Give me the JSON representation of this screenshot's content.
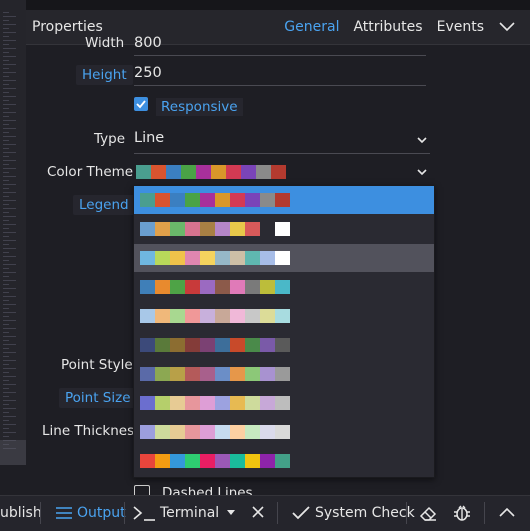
{
  "header": {
    "title": "Properties",
    "tabs": [
      {
        "label": "General",
        "active": true
      },
      {
        "label": "Attributes",
        "active": false
      },
      {
        "label": "Events",
        "active": false
      }
    ]
  },
  "fields": {
    "width_label": "Width",
    "width_value": "800",
    "height_label": "Height",
    "height_value": "250",
    "responsive_label": "Responsive",
    "responsive_checked": true,
    "type_label": "Type",
    "type_value": "Line",
    "color_theme_label": "Color Theme",
    "legend_label": "Legend",
    "point_style_label": "Point Style",
    "point_size_label": "Point Size",
    "line_thickness_label": "Line Thickness",
    "dashed_lines_label": "Dashed Lines"
  },
  "color_theme_selected": [
    "#4a9e8f",
    "#d9542f",
    "#3b7fc1",
    "#4aa346",
    "#a8309b",
    "#d9972a",
    "#d33a53",
    "#7a44b8",
    "#8a8a8a",
    "#b33a2f"
  ],
  "color_themes": [
    [
      "#4a9e8f",
      "#d9542f",
      "#3b7fc1",
      "#4aa346",
      "#a8309b",
      "#d9972a",
      "#d33a53",
      "#7a44b8",
      "#8a8a8a",
      "#b33a2f"
    ],
    [
      "#6a9ecf",
      "#e0a04a",
      "#6ab86a",
      "#d7738f",
      "#a88044",
      "#b586c7",
      "#e7c84a",
      "#d85a5a",
      "#2a2a32",
      "#ffffff"
    ],
    [
      "#6fb7e0",
      "#b8d85a",
      "#f0c24a",
      "#e086b0",
      "#f4d35e",
      "#96b8c8",
      "#cdbfa6",
      "#5fb8b0",
      "#a7bde8",
      "#ffffff"
    ],
    [
      "#3f7fb8",
      "#e88a2e",
      "#4ea346",
      "#c83a3a",
      "#9b6ac1",
      "#8c5a4a",
      "#e07ab8",
      "#7a7a7a",
      "#bcbd3a",
      "#4ab8c8"
    ],
    [
      "#a8c8e8",
      "#f0b87a",
      "#a8d890",
      "#f09898",
      "#c8b0dc",
      "#c8a898",
      "#f0b8d8",
      "#c8c8c8",
      "#dcdc98",
      "#a8dce0"
    ],
    [
      "#3c4a7a",
      "#5a7a3a",
      "#8c6d31",
      "#843c39",
      "#7b4173",
      "#3d6e9a",
      "#c84a2a",
      "#4a8a4a",
      "#7a5aa8",
      "#5a5a5a"
    ],
    [
      "#5a6aa8",
      "#8ca852",
      "#b8a048",
      "#b45a5a",
      "#a8608c",
      "#6b8ec7",
      "#e6974a",
      "#8cc878",
      "#a892d0",
      "#9a9a9a"
    ],
    [
      "#6b6ecf",
      "#b5cf6b",
      "#e7cb94",
      "#e7969c",
      "#de9ed6",
      "#9ca2e0",
      "#e7ba52",
      "#cedb9c",
      "#c7a8d8",
      "#bdbdbd"
    ],
    [
      "#9c9ede",
      "#cedb9c",
      "#e7cb94",
      "#e7969c",
      "#de9ed6",
      "#c6dbef",
      "#fdd0a2",
      "#c7e9c0",
      "#dadaeb",
      "#d9d9d9"
    ],
    [
      "#e8453c",
      "#f39c12",
      "#3498db",
      "#2ecc71",
      "#e91e63",
      "#9b59b6",
      "#1abc9c",
      "#f1c40f",
      "#8e24aa",
      "#43a088"
    ]
  ],
  "bottombar": {
    "publish": "ublish",
    "output": "Output",
    "terminal": "Terminal",
    "system_check": "System Check"
  }
}
